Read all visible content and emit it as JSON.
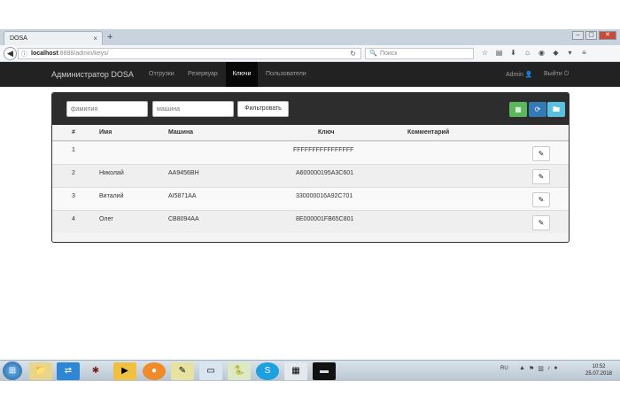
{
  "browser": {
    "tab_title": "DOSA",
    "tab_close": "×",
    "new_tab": "+",
    "url_host": "localhost",
    "url_path": ":8888/admin/keys/",
    "search_placeholder": "Поиск",
    "window_buttons": [
      "–",
      "▢",
      "✕"
    ]
  },
  "app": {
    "brand": "Администратор DOSA",
    "nav": [
      "Отгрузки",
      "Резервуар",
      "Ключи",
      "Пользователи"
    ],
    "active_nav": "Ключи",
    "user": "Admin",
    "logout": "Выйти"
  },
  "filters": {
    "surname_placeholder": "фамилия",
    "car_placeholder": "машина",
    "filter_button": "Фильтровать"
  },
  "table": {
    "headers": [
      "#",
      "Имя",
      "Машина",
      "Ключ",
      "Комментарий"
    ],
    "rows": [
      {
        "num": "1",
        "name": "",
        "car": "",
        "key": "FFFFFFFFFFFFFFFF",
        "comment": ""
      },
      {
        "num": "2",
        "name": "Николай",
        "car": "AA9456BH",
        "key": "A600000195A3C601",
        "comment": ""
      },
      {
        "num": "3",
        "name": "Виталий",
        "car": "AI5871AA",
        "key": "330000016A92C701",
        "comment": ""
      },
      {
        "num": "4",
        "name": "Олег",
        "car": "CB8094AA",
        "key": "8E000001FB65C801",
        "comment": ""
      }
    ]
  },
  "taskbar": {
    "lang": "RU",
    "time": "10:52",
    "date": "25.07.2018"
  },
  "colors": {
    "app_header": "#222222",
    "btn_green": "#5cb85c",
    "btn_blue": "#337ab7",
    "btn_cyan": "#5bc0de"
  }
}
